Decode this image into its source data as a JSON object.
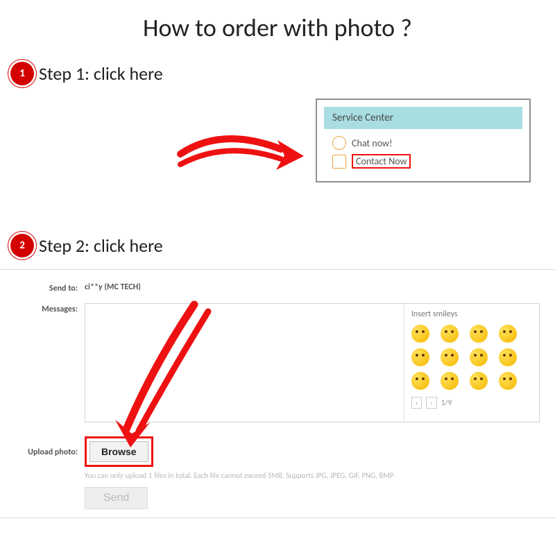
{
  "title": "How to order with photo ?",
  "step1": {
    "badge": "1",
    "label": "Step 1: click here"
  },
  "service_center": {
    "header": "Service Center",
    "chat": "Chat now!",
    "contact": "Contact Now"
  },
  "step2": {
    "badge": "2",
    "label": "Step 2: click here"
  },
  "form": {
    "sendto_label": "Send to:",
    "sendto_value": "ci**y (MC TECH)",
    "messages_label": "Messages:",
    "smileys_title": "Insert smileys",
    "pager_prev": "‹",
    "pager_next": "›",
    "pager_page": "1/9",
    "upload_label": "Upload photo:",
    "browse": "Browse",
    "hint": "You can only upload 1 files in total. Each file cannot exceed 5MB. Supports JPG, JPEG, GIF, PNG, BMP",
    "send": "Send"
  }
}
